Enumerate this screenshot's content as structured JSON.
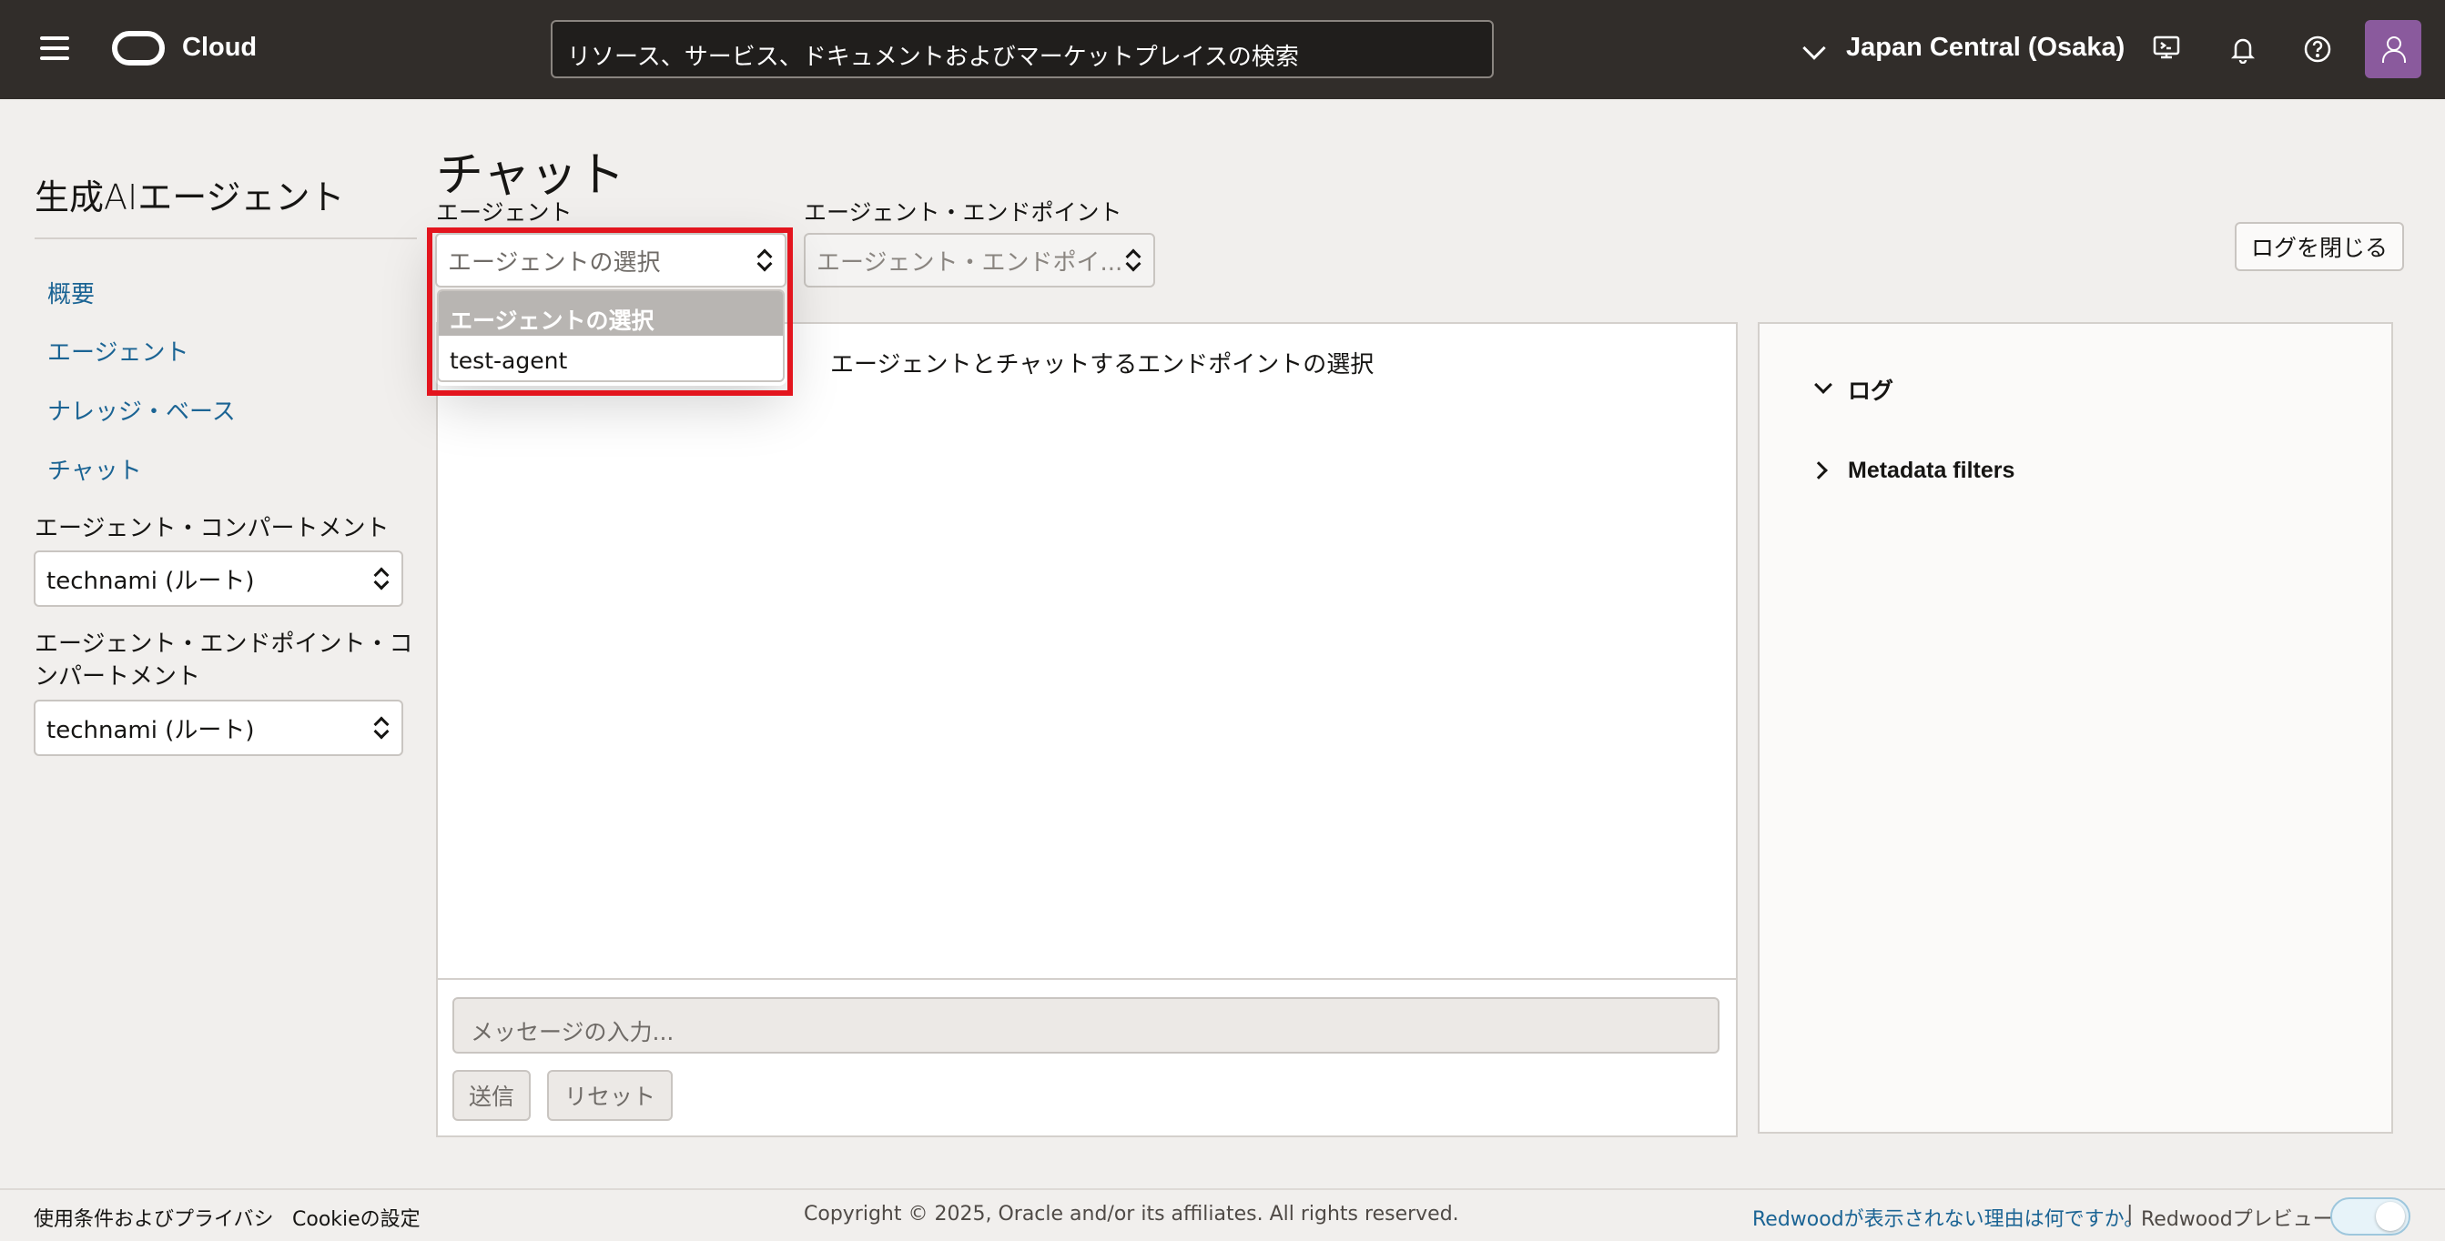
{
  "header": {
    "brand": "Cloud",
    "search_placeholder": "リソース、サービス、ドキュメントおよびマーケットプレイスの検索",
    "region": "Japan Central (Osaka)",
    "icons": [
      "menu-icon",
      "oracle-logo-icon",
      "chevron-down-icon",
      "cloud-shell-icon",
      "bell-icon",
      "help-icon",
      "user-avatar-icon"
    ]
  },
  "sidebar": {
    "title": "生成AIエージェント",
    "items": [
      {
        "label": "概要"
      },
      {
        "label": "エージェント"
      },
      {
        "label": "ナレッジ・ベース"
      },
      {
        "label": "チャット"
      }
    ],
    "agent_compartment_label": "エージェント・コンパートメント",
    "agent_compartment_value": "technami (ルート)",
    "endpoint_compartment_label": "エージェント・エンドポイント・コンパートメント",
    "endpoint_compartment_label_line1": "エージェント・エンドポイント・コ",
    "endpoint_compartment_label_line2": "ンパートメント",
    "endpoint_compartment_value": "technami (ルート)"
  },
  "main": {
    "title": "チャット",
    "agent_label": "エージェント",
    "agent_select_value": "エージェントの選択",
    "endpoint_label": "エージェント・エンドポイント",
    "endpoint_select_value": "エージェント・エンドポイ...",
    "close_log_button": "ログを閉じる",
    "chat_hint": "エージェントとチャットするエンドポイントの選択",
    "message_placeholder": "メッセージの入力...",
    "send_button": "送信",
    "reset_button": "リセット"
  },
  "dropdown": {
    "options": [
      {
        "label": "エージェントの選択",
        "selected": true
      },
      {
        "label": "test-agent",
        "selected": false
      }
    ]
  },
  "log_panel": {
    "log_section": "ログ",
    "metadata_section": "Metadata filters"
  },
  "footer": {
    "terms": "使用条件およびプライバシ",
    "cookie": "Cookieの設定",
    "copyright": "Copyright © 2025, Oracle and/or its affiliates. All rights reserved.",
    "redwood_question": "Redwoodが表示されない理由は何ですか。",
    "separator": "|",
    "redwood_preview": "Redwoodプレビュー"
  },
  "colors": {
    "topbar": "#312d2a",
    "link": "#1b6494",
    "highlight": "#e3151e",
    "avatar": "#8a5a9d"
  }
}
